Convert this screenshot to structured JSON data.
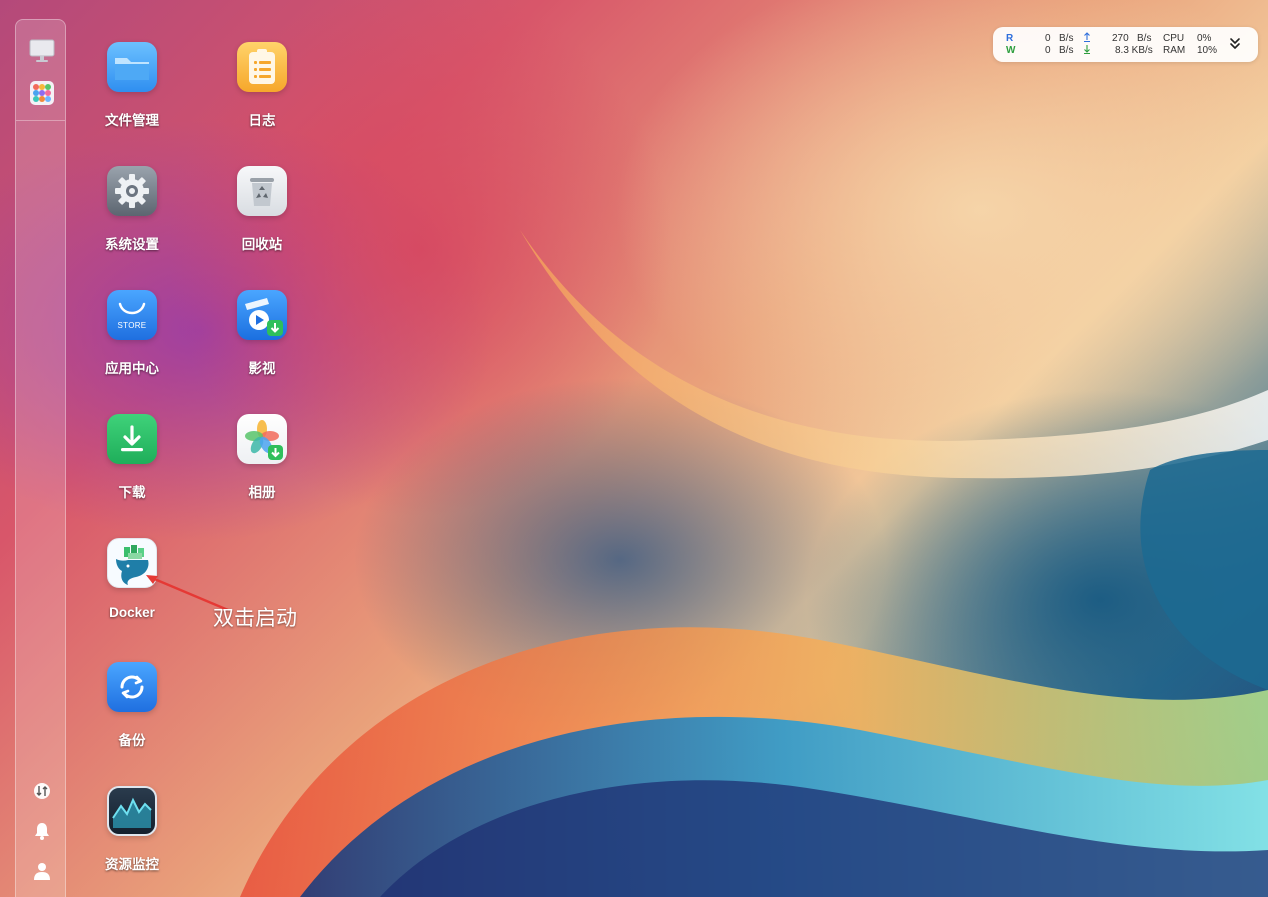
{
  "desktop": {
    "apps": [
      {
        "name": "file-manager",
        "label": "文件管理",
        "icon": "folder-icon"
      },
      {
        "name": "log",
        "label": "日志",
        "icon": "notepad-icon"
      },
      {
        "name": "system-settings",
        "label": "系统设置",
        "icon": "gear-icon"
      },
      {
        "name": "recycle-bin",
        "label": "回收站",
        "icon": "recycle-icon"
      },
      {
        "name": "app-center",
        "label": "应用中心",
        "icon": "store-bag-icon",
        "icon_text": "STORE"
      },
      {
        "name": "video",
        "label": "影视",
        "icon": "clapper-play-icon"
      },
      {
        "name": "download",
        "label": "下载",
        "icon": "download-arrow-icon"
      },
      {
        "name": "photos",
        "label": "相册",
        "icon": "pinwheel-icon"
      },
      {
        "name": "docker",
        "label": "Docker",
        "icon": "whale-containers-icon"
      },
      {
        "name": "backup",
        "label": "备份",
        "icon": "sync-icon"
      },
      {
        "name": "resource-monitor",
        "label": "资源监控",
        "icon": "activity-chart-icon"
      }
    ]
  },
  "annotation": {
    "text": "双击启动",
    "color": "#e53935"
  },
  "status_widget": {
    "read_label": "R",
    "write_label": "W",
    "read_value": "0",
    "write_value": "0",
    "read_unit": "B/s",
    "write_unit": "B/s",
    "upload_value": "270",
    "upload_unit": "B/s",
    "download_value": "8.3 KB/s",
    "cpu_label": "CPU",
    "cpu_value": "0%",
    "ram_label": "RAM",
    "ram_value": "10%",
    "upload_icon": "upload-arrow-icon",
    "download_icon": "download-arrow-icon",
    "expand_icon": "double-chevron-down-icon"
  },
  "dock": {
    "top_items": [
      "monitor-icon",
      "app-grid-icon"
    ],
    "bottom_items": [
      "transfer-icon",
      "bell-icon",
      "user-icon"
    ]
  },
  "colors": {
    "read": "#2f6fdc",
    "write": "#2e9e3e",
    "accent": "#2f7de1"
  }
}
